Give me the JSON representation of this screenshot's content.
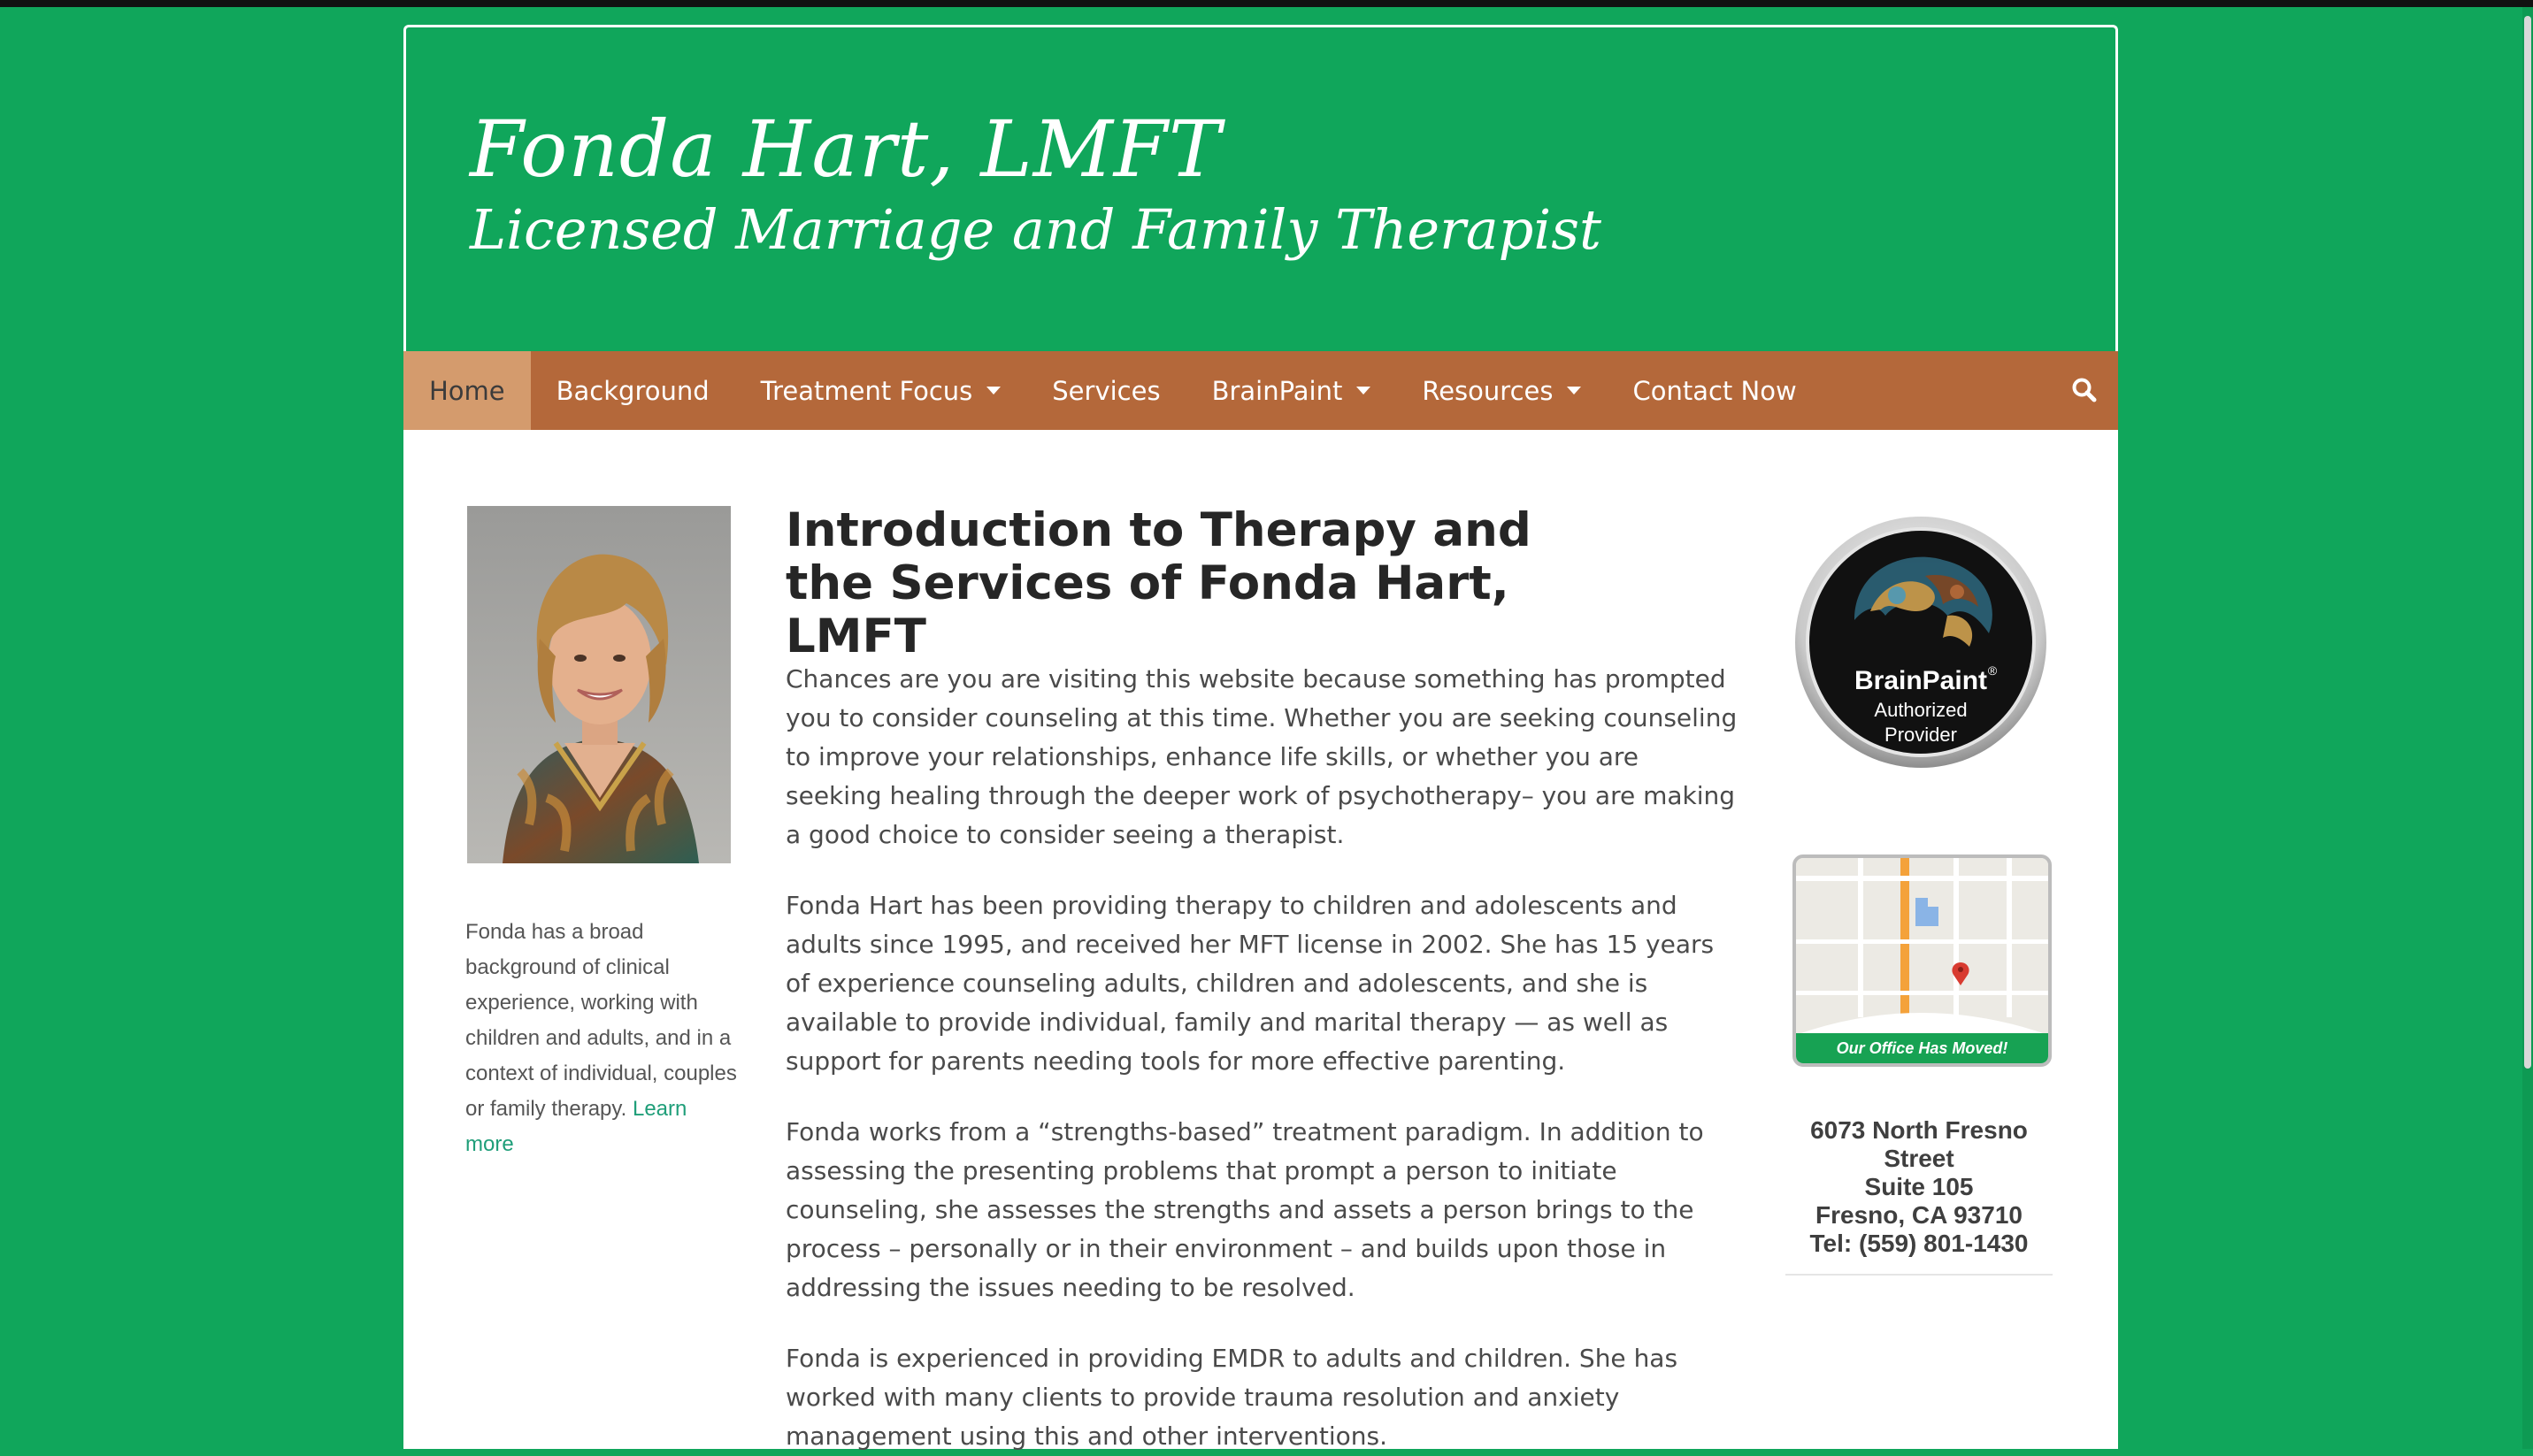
{
  "header": {
    "title": "Fonda Hart, LMFT",
    "tagline": "Licensed Marriage and Family Therapist"
  },
  "nav": {
    "items": [
      {
        "label": "Home",
        "active": true,
        "dropdown": false
      },
      {
        "label": "Background",
        "active": false,
        "dropdown": false
      },
      {
        "label": "Treatment Focus",
        "active": false,
        "dropdown": true
      },
      {
        "label": "Services",
        "active": false,
        "dropdown": false
      },
      {
        "label": "BrainPaint",
        "active": false,
        "dropdown": true
      },
      {
        "label": "Resources",
        "active": false,
        "dropdown": true
      },
      {
        "label": "Contact Now",
        "active": false,
        "dropdown": false
      }
    ],
    "search_icon": "search-icon"
  },
  "sidebar": {
    "bio": "Fonda has a broad background of clinical experience, working with children and adults, and in a context of individual, couples or family therapy.",
    "learn_more": "Learn more"
  },
  "main": {
    "title": "Introduction to Therapy and the Services of Fonda Hart, LMFT",
    "paragraphs": [
      "Chances are you are visiting this website because something has prompted you to consider counseling at this time. Whether you are seeking counseling to improve your relationships, enhance life skills, or whether you are seeking healing through the deeper work of psychotherapy– you are making a good choice to consider seeing a therapist.",
      "Fonda Hart has been providing therapy to children and adolescents and adults since 1995, and received her MFT license in 2002. She has 15 years of experience counseling adults, children and adolescents, and she is available to provide individual, family and marital therapy — as well as support for parents needing tools for more effective parenting.",
      "Fonda works from a “strengths-based” treatment paradigm. In addition to assessing the presenting problems that prompt a person to initiate counseling, she assesses the strengths and assets a person brings to the process – personally or in their environment – and builds upon those in addressing the issues needing to be resolved.",
      "Fonda is experienced in providing EMDR to adults and children. She has worked with many clients to provide trauma resolution and anxiety management using this and other interventions."
    ]
  },
  "right": {
    "badge": {
      "brand": "BrainPaint",
      "reg": "®",
      "line1": "Authorized",
      "line2": "Provider"
    },
    "map": {
      "banner": "Our Office Has Moved!"
    },
    "address": {
      "line1": "6073 North Fresno",
      "line2": "Street",
      "line3": "Suite 105",
      "line4": "Fresno, CA 93710",
      "line5": "Tel: (559) 801-1430"
    }
  },
  "colors": {
    "background": "#10a65b",
    "nav": "#b4683a",
    "nav_active": "#d49b6d",
    "link": "#1f9e79"
  }
}
